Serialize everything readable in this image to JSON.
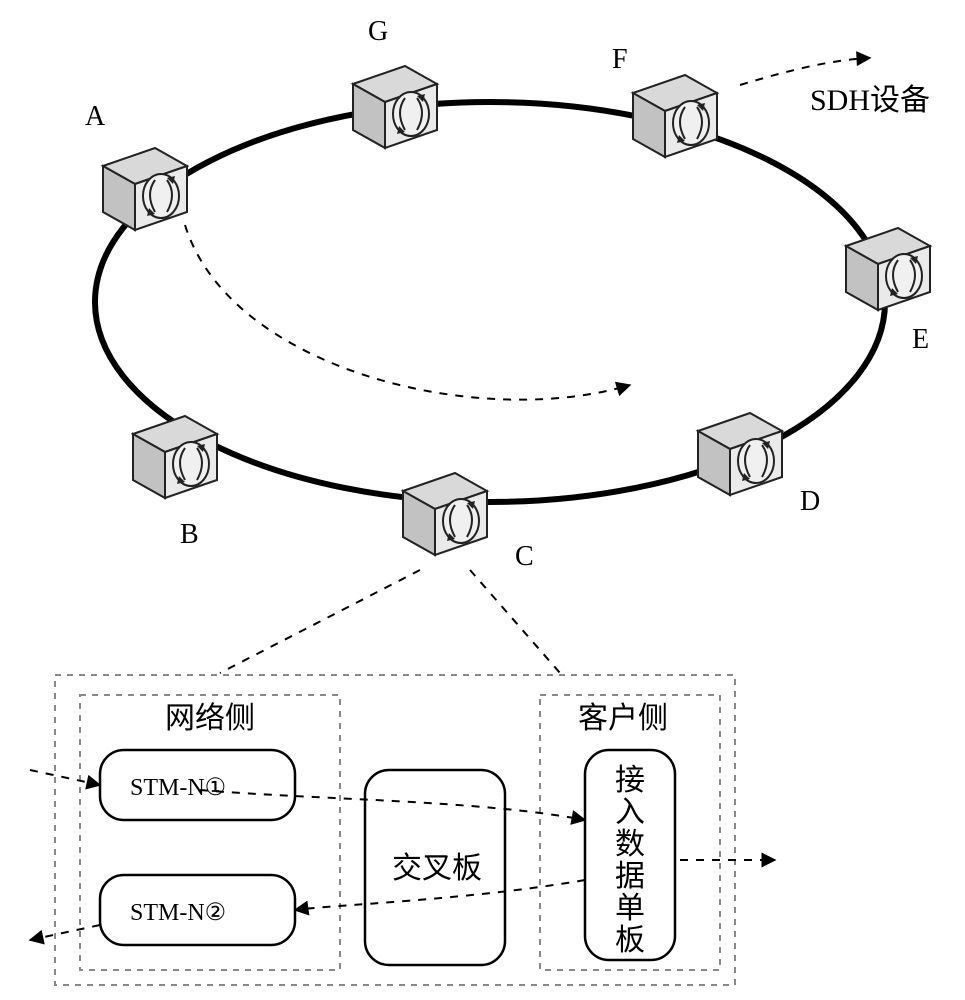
{
  "nodes": {
    "A": "A",
    "B": "B",
    "C": "C",
    "D": "D",
    "E": "E",
    "F": "F",
    "G": "G"
  },
  "legend": {
    "sdh": "SDH设备"
  },
  "detail": {
    "network_side": "网络侧",
    "client_side": "客户侧",
    "stm1": "STM-N①",
    "stm2": "STM-N②",
    "cross": "交叉板",
    "access_line1": "接",
    "access_line2": "入",
    "access_line3": "数",
    "access_line4": "据",
    "access_line5": "单",
    "access_line6": "板"
  }
}
